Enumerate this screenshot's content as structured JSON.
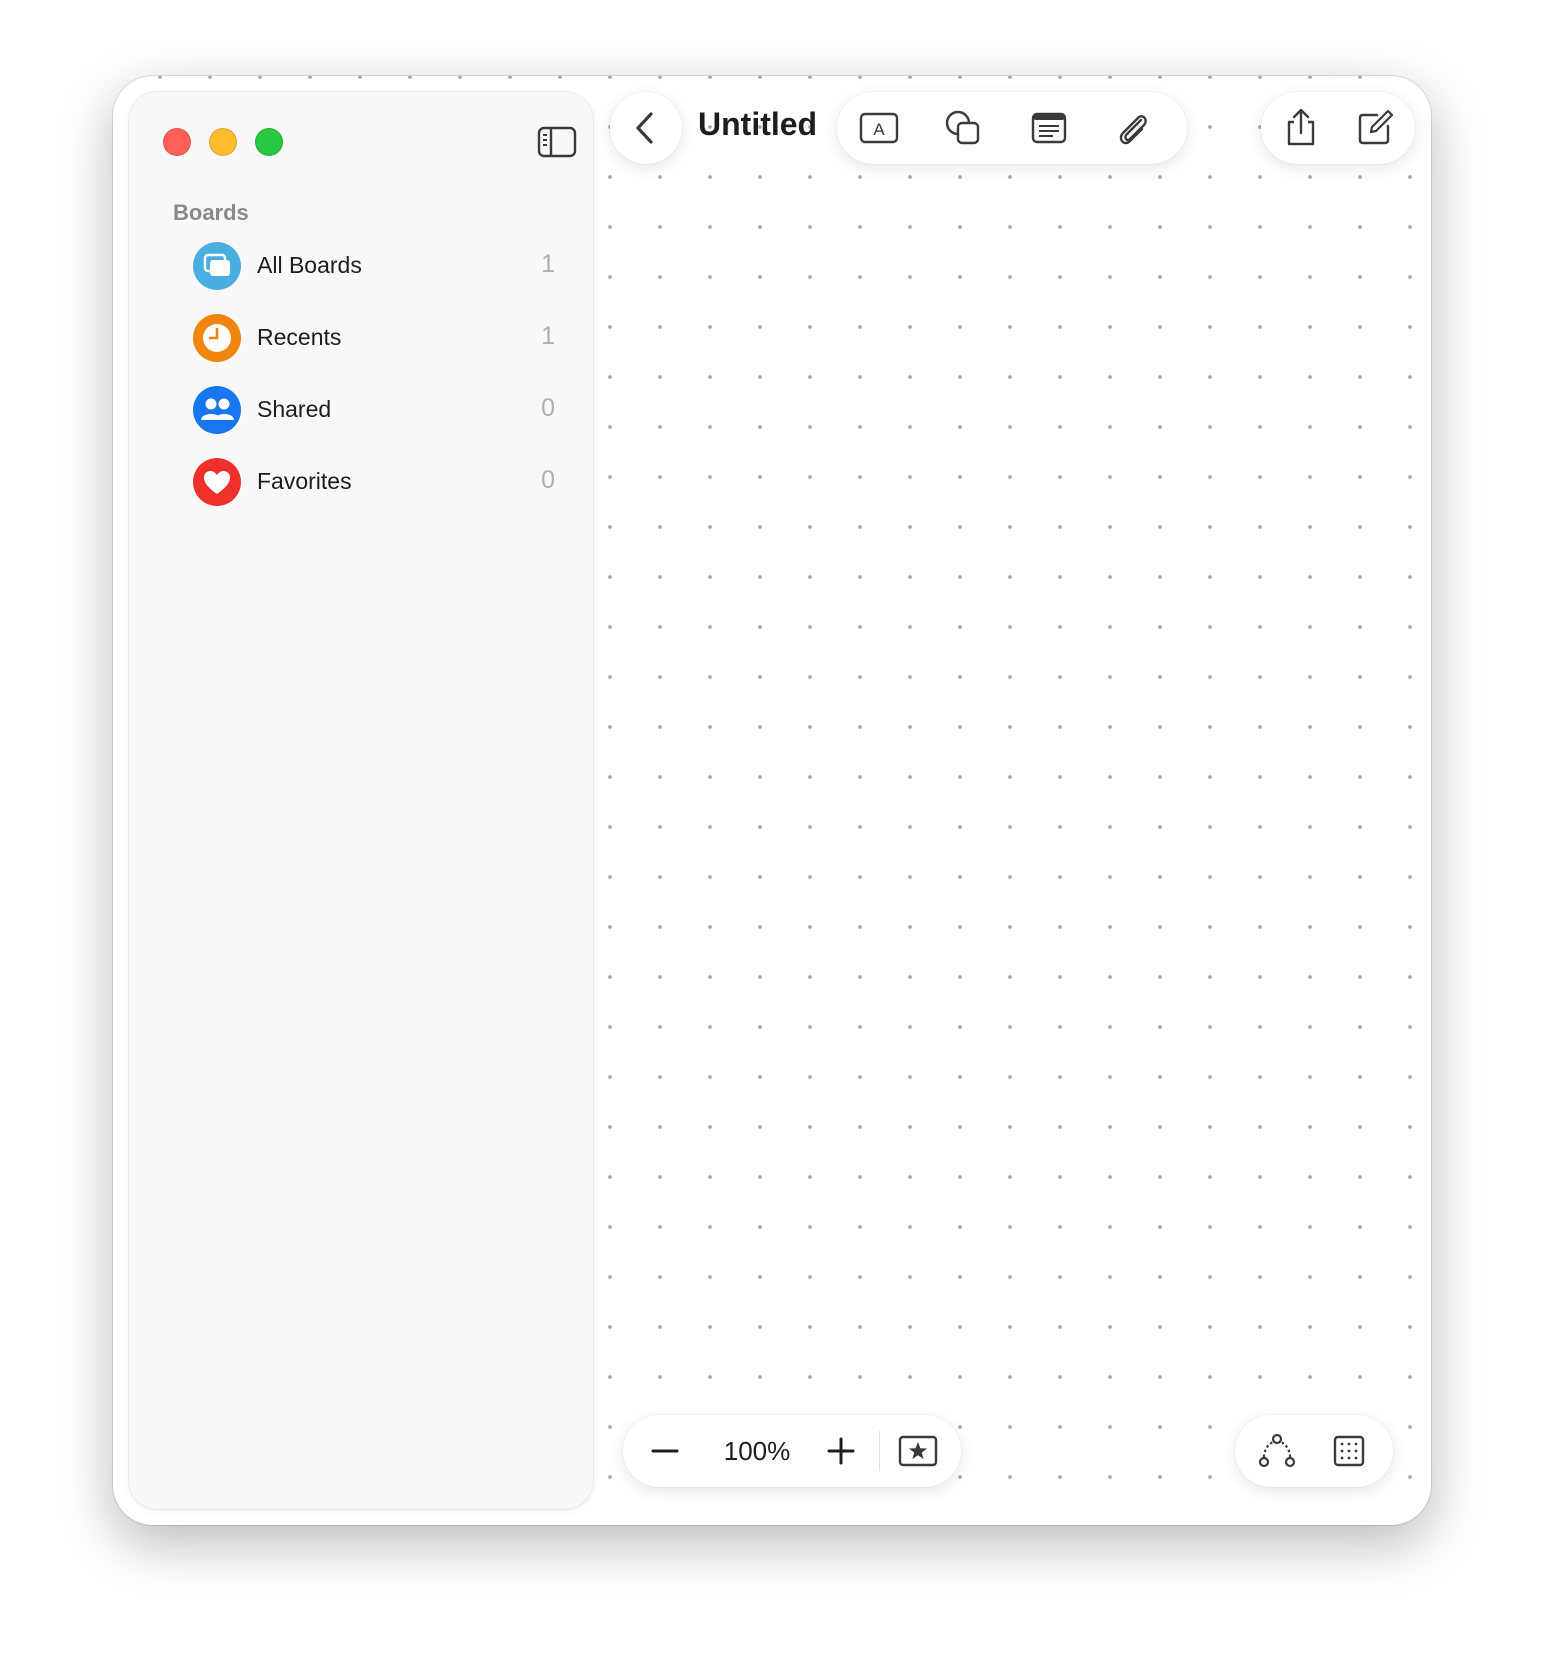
{
  "window": {
    "title": "Untitled"
  },
  "sidebar": {
    "section_title": "Boards",
    "items": [
      {
        "label": "All Boards",
        "count": "1",
        "icon": "all-boards-icon",
        "color": "#4aaee0"
      },
      {
        "label": "Recents",
        "count": "1",
        "icon": "clock-icon",
        "color": "#f0860e"
      },
      {
        "label": "Shared",
        "count": "0",
        "icon": "people-icon",
        "color": "#1677ee"
      },
      {
        "label": "Favorites",
        "count": "0",
        "icon": "heart-icon",
        "color": "#f0302a"
      }
    ]
  },
  "toolbar": {
    "tools": [
      "text-box-icon",
      "shapes-icon",
      "sticky-note-icon",
      "attachment-icon"
    ],
    "right": [
      "share-icon",
      "new-board-icon"
    ]
  },
  "zoom": {
    "value": "100%"
  },
  "bottom_right": {
    "tools": [
      "connection-icon",
      "grid-icon"
    ]
  }
}
